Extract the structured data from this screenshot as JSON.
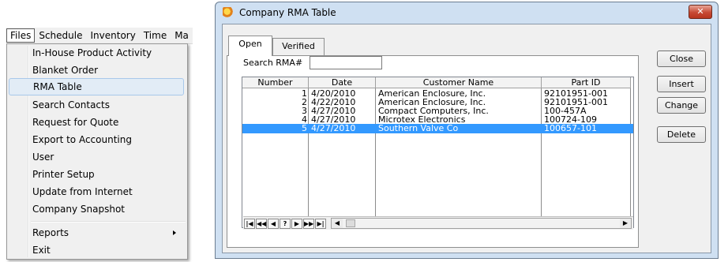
{
  "menubar": {
    "items": [
      "Files",
      "Schedule",
      "Inventory",
      "Time",
      "Ma"
    ]
  },
  "files_menu": {
    "items": [
      {
        "label": "In-House Product Activity"
      },
      {
        "label": "Blanket Order"
      },
      {
        "label": "RMA Table"
      },
      {
        "label": "Search Contacts"
      },
      {
        "label": "Request for Quote"
      },
      {
        "label": "Export to Accounting"
      },
      {
        "label": "User"
      },
      {
        "label": "Printer Setup"
      },
      {
        "label": "Update from Internet"
      },
      {
        "label": "Company Snapshot"
      },
      {
        "label": "Reports"
      },
      {
        "label": "Exit"
      }
    ],
    "highlighted": "RMA Table"
  },
  "dialog": {
    "title": "Company RMA Table",
    "close_glyph": "✕",
    "tabs": [
      "Open",
      "Verified"
    ],
    "active_tab": "Open",
    "search": {
      "label": "Search RMA#",
      "value": ""
    },
    "grid": {
      "columns": [
        "Number",
        "Date",
        "Customer Name",
        "Part ID"
      ],
      "rows": [
        {
          "number": "1",
          "date": "4/20/2010",
          "customer": "American Enclosure, Inc.",
          "part": "92101951-001"
        },
        {
          "number": "2",
          "date": "4/22/2010",
          "customer": "American Enclosure, Inc.",
          "part": "92101951-001"
        },
        {
          "number": "3",
          "date": "4/27/2010",
          "customer": "Compact Computers, Inc.",
          "part": "100-457A"
        },
        {
          "number": "4",
          "date": "4/27/2010",
          "customer": "Microtex Electronics",
          "part": "100724-109"
        },
        {
          "number": "5",
          "date": "4/27/2010",
          "customer": "Southern Valve Co",
          "part": "100657-101"
        }
      ],
      "selected_row": 5,
      "navigator": [
        "|◀",
        "◀◀",
        "◀",
        "?",
        "▶",
        "▶▶",
        "▶|"
      ],
      "scroll_left": "◀",
      "scroll_right": "▶"
    },
    "buttons": [
      "Close",
      "Insert",
      "Change",
      "Delete"
    ]
  }
}
